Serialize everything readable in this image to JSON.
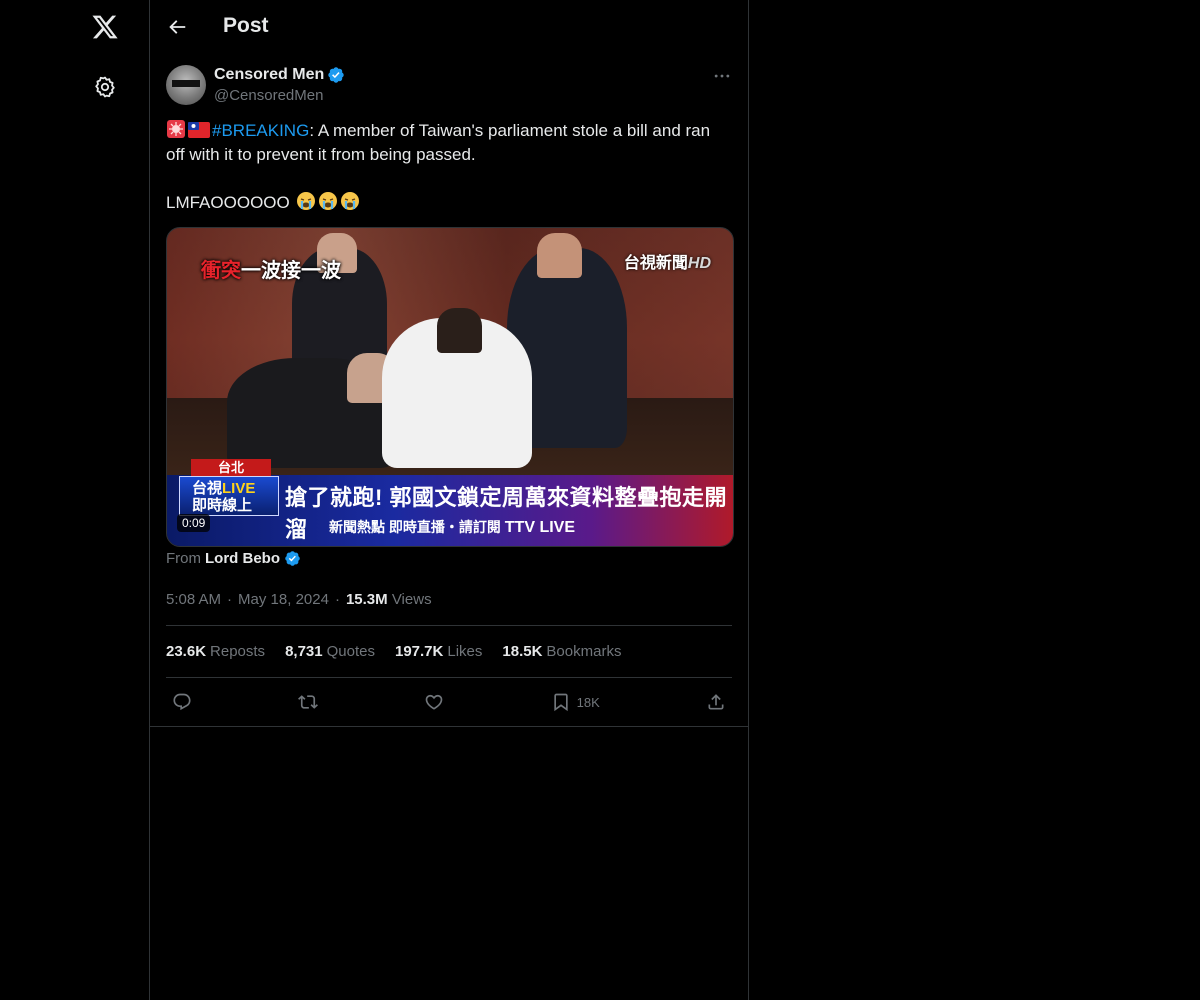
{
  "header": {
    "title": "Post"
  },
  "tweet": {
    "display_name": "Censored Men",
    "handle": "@CensoredMen",
    "text_hashtag": "#BREAKING",
    "text_body": ": A member of Taiwan's parliament stole a bill and ran off with it to prevent it from being passed.",
    "text_line2": "LMFAOOOOOO",
    "media": {
      "chyron_top_red": "衝突",
      "chyron_top_white": "一波接一波",
      "channel": "台視新聞",
      "channel_hd": "HD",
      "location": "台北",
      "live_label_1": "台視",
      "live_label_live": "LIVE",
      "live_label_2": "即時線上",
      "headline": "搶了就跑! 郭國文鎖定周萬來資料整疊抱走開溜",
      "ticker": "新聞熱點 即時直播・請訂閱",
      "ticker_brand": "TTV LIVE",
      "duration": "0:09"
    },
    "from_label": "From",
    "from_source": "Lord Bebo",
    "time": "5:08 AM",
    "date": "May 18, 2024",
    "views_count": "15.3M",
    "views_label": "Views",
    "stats": {
      "reposts_count": "23.6K",
      "reposts_label": "Reposts",
      "quotes_count": "8,731",
      "quotes_label": "Quotes",
      "likes_count": "197.7K",
      "likes_label": "Likes",
      "bookmarks_count": "18.5K",
      "bookmarks_label": "Bookmarks"
    },
    "actions": {
      "bookmark_count": "18K"
    }
  },
  "colors": {
    "background": "#000000",
    "text_primary": "#e7e9ea",
    "text_secondary": "#71767b",
    "accent": "#1d9bf0",
    "border": "#2f3336"
  },
  "icons": {
    "logo": "x-logo-icon",
    "settings": "gear-icon",
    "back": "arrow-left-icon",
    "more": "more-dots-icon",
    "verified": "verified-badge-icon",
    "reply": "reply-icon",
    "repost": "repost-icon",
    "like": "heart-icon",
    "bookmark": "bookmark-icon",
    "share": "share-icon"
  }
}
